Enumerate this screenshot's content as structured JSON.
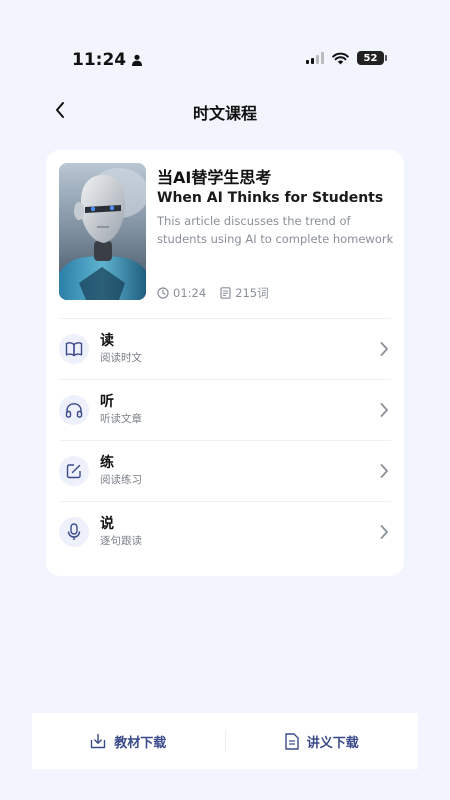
{
  "status_bar": {
    "time": "11:24",
    "battery": "52"
  },
  "nav": {
    "title": "时文课程"
  },
  "article": {
    "title_cn": "当AI替学生思考",
    "title_en": "When AI Thinks for Students",
    "desc_line1": "This article discusses the trend of",
    "desc_line2": "students using AI to complete homework...",
    "duration": "01:24",
    "word_count": "215词"
  },
  "menu": [
    {
      "title": "读",
      "subtitle": "阅读时文",
      "icon": "book-icon"
    },
    {
      "title": "听",
      "subtitle": "听读文章",
      "icon": "headphones-icon"
    },
    {
      "title": "练",
      "subtitle": "阅读练习",
      "icon": "edit-icon"
    },
    {
      "title": "说",
      "subtitle": "逐句跟读",
      "icon": "microphone-icon"
    }
  ],
  "bottom": {
    "textbook_download": "教材下载",
    "handout_download": "讲义下载"
  },
  "colors": {
    "accent": "#3b4a8a",
    "background": "#f2f5fd"
  }
}
